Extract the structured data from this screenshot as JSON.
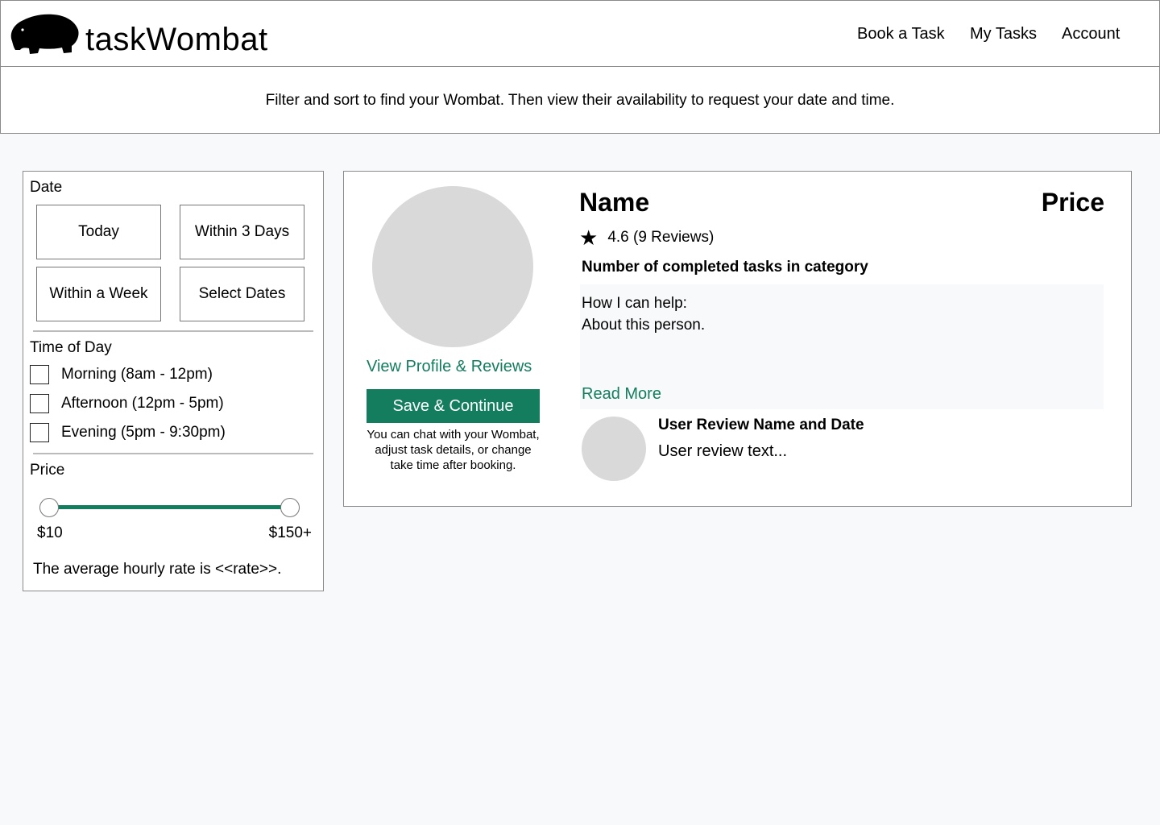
{
  "header": {
    "brand": "taskWombat",
    "logo_icon": "wombat-icon",
    "nav": [
      "Book a Task",
      "My Tasks",
      "Account"
    ]
  },
  "banner": {
    "text": "Filter and sort to find your Wombat. Then view their availability to request your date and time."
  },
  "filters": {
    "date": {
      "label": "Date",
      "options": [
        "Today",
        "Within 3 Days",
        "Within a Week",
        "Select Dates"
      ]
    },
    "time_of_day": {
      "label": "Time of Day",
      "options": [
        "Morning (8am - 12pm)",
        "Afternoon (12pm - 5pm)",
        "Evening (5pm - 9:30pm)"
      ],
      "checked": [
        false,
        false,
        false
      ]
    },
    "price": {
      "label": "Price",
      "min_label": "$10",
      "max_label": "$150+",
      "selected_range_fraction": [
        0,
        1
      ],
      "accent_color": "#137d5e"
    },
    "avg_rate_text": "The average hourly rate is <<rate>>."
  },
  "tasker_card": {
    "name": "Name",
    "price": "Price",
    "star_icon": "star-icon",
    "rating_text": "4.6 (9 Reviews)",
    "completed_tasks": "Number of completed tasks in category",
    "help_label": "How I can help:",
    "about": "About this person.",
    "read_more": "Read More",
    "profile_link": "View Profile & Reviews",
    "save_button": "Save & Continue",
    "save_note": "You can chat with your Wombat, adjust task details, or change take time after booking.",
    "review": {
      "name_date": "User Review Name and Date",
      "text": "User review text..."
    }
  },
  "colors": {
    "accent": "#137d5e",
    "background": "#f8f9fa",
    "placeholder": "#d9d9d9"
  }
}
